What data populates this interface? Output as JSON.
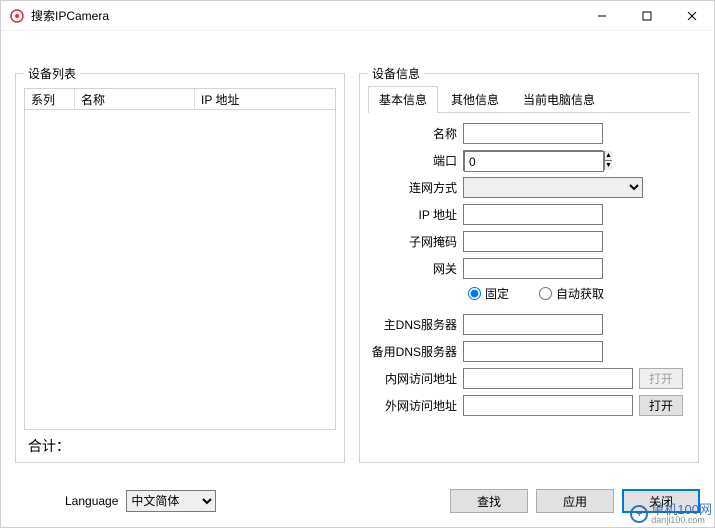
{
  "window": {
    "title": "搜索IPCamera"
  },
  "deviceList": {
    "legend": "设备列表",
    "columns": {
      "series": "系列",
      "name": "名称",
      "ip": "IP 地址"
    },
    "totalLabel": "合计："
  },
  "deviceInfo": {
    "legend": "设备信息",
    "tabs": {
      "basic": "基本信息",
      "other": "其他信息",
      "pc": "当前电脑信息"
    },
    "fields": {
      "nameLabel": "名称",
      "nameValue": "",
      "portLabel": "端口",
      "portValue": "0",
      "netModeLabel": "连网方式",
      "netModeValue": "",
      "ipLabel": "IP 地址",
      "ipValue": "",
      "maskLabel": "子网掩码",
      "maskValue": "",
      "gatewayLabel": "网关",
      "gatewayValue": "",
      "radioFixed": "固定",
      "radioAuto": "自动获取",
      "dns1Label": "主DNS服务器",
      "dns1Value": "",
      "dns2Label": "备用DNS服务器",
      "dns2Value": "",
      "innerUrlLabel": "内网访问地址",
      "innerUrlValue": "",
      "outerUrlLabel": "外网访问地址",
      "outerUrlValue": "",
      "openBtn": "打开"
    }
  },
  "language": {
    "label": "Language",
    "value": "中文简体"
  },
  "buttons": {
    "search": "查找",
    "apply": "应用",
    "close": "关闭"
  },
  "watermark": {
    "text": "单机100网",
    "sub": "danji100.com"
  }
}
